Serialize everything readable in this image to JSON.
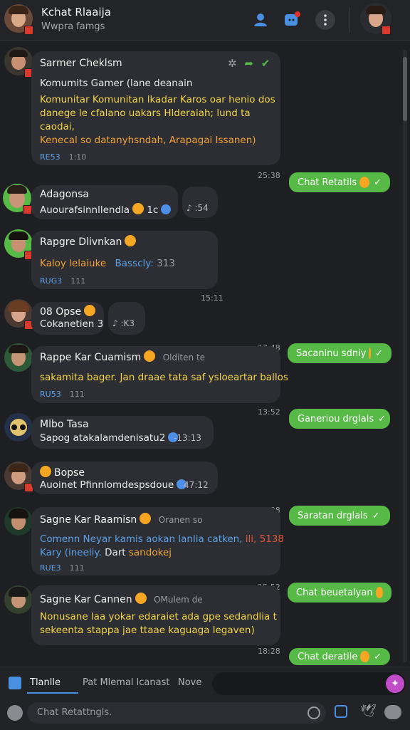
{
  "header": {
    "title": "Kchat Rlaaija",
    "subtitle": "Wwpra famgs",
    "icons": [
      "user-icon",
      "notification-icon",
      "more-icon"
    ]
  },
  "messages": [
    {
      "sender": "Sarmer Cheklsm",
      "lines": [
        "Komumits Gamer (lane deanain",
        "Komunitar Komunitan lkadar Karos oar henio dos",
        "danege le cfalano uakars Hlderaiah; lund ta",
        "caodai,",
        "Kenecal so datanyhsndah, Arapagai Issanen)"
      ],
      "tag": "RE53",
      "meta": "1:10"
    },
    {
      "sender": "Adagonsa",
      "lines": [
        "Auourafsinnllendla"
      ],
      "extra": "1c",
      "duration": "♪ :54"
    },
    {
      "sender": "Rapgre Dlivnkan",
      "lines": [
        "Kaloy lelaiuke",
        "Basscly:"
      ],
      "count": "313",
      "tag": "RUG3",
      "meta": "111"
    },
    {
      "sender": "08 Opse",
      "lines": [
        "Cokanetien 3"
      ],
      "duration": "♪ :K3"
    },
    {
      "sender": "Rappe Kar Cuamism",
      "status": "Olditen te",
      "lines": [
        "sakamita bager. Jan draae tata saf ysloeartar ballos"
      ],
      "tag": "RU53",
      "meta": "111"
    },
    {
      "sender": "Mlbo Tasa",
      "lines": [
        "Sapog atakalamdenisatu2"
      ],
      "duration": "-13:13"
    },
    {
      "sender": "Bopse",
      "lines": [
        "Auoinet Pfinnlomdespsdoue"
      ],
      "duration": "47:12"
    },
    {
      "sender": "Sagne Kar Raamisn",
      "status": "Oranen so",
      "lines": [
        "Comenn Neyar kamis aokan lanlia catken,",
        "Kary (ineeliy.",
        "Dart",
        "sandokej"
      ],
      "count": "ili, 5138",
      "tag": "RUE3",
      "meta": "111"
    },
    {
      "sender": "Sagne Kar Cannen",
      "status": "OMulem de",
      "lines": [
        "Nonusane laa yokar edaraiet ada gpe sedandlia t",
        "sekeenta stappa jae ttaae kaguaga legaven)"
      ]
    }
  ],
  "outgoing": [
    {
      "time": "25:38",
      "text": "Chat Retatils"
    },
    {
      "time": "15:11",
      "text": ""
    },
    {
      "time": "13:48",
      "text": "Sacaninu sdniy"
    },
    {
      "time": "13:52",
      "text": "Ganeriou drglals"
    },
    {
      "time": "13:38",
      "text": "Saratan drglals"
    },
    {
      "time": "15:52",
      "text": "Chat beuetalyan"
    },
    {
      "time": "18:28",
      "text": "Chat deratile"
    }
  ],
  "tabs": [
    "Tlanlle",
    "Pat Mlemal lcanast",
    "Nove"
  ],
  "input": {
    "placeholder": "Chat Retattngls."
  },
  "colors": {
    "accent_green": "#57b946",
    "bubble": "#2d2e33",
    "background": "#1e1f23",
    "link_blue": "#5aa0e8",
    "highlight_yellow": "#f3d54a",
    "highlight_orange": "#f0a33a"
  }
}
